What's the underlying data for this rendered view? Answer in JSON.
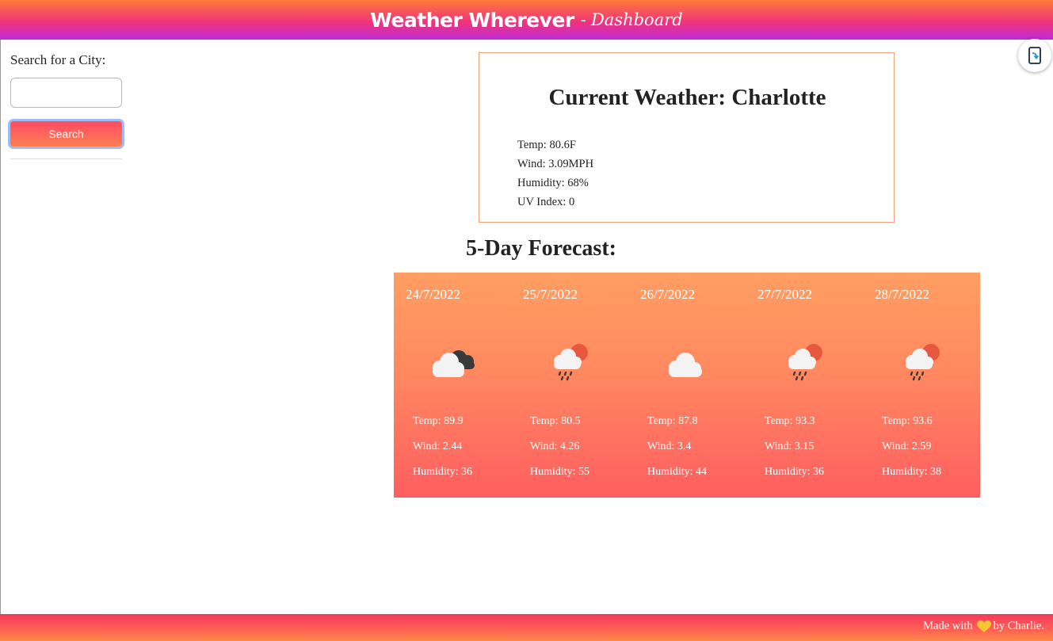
{
  "header": {
    "brand": "Weather Wherever",
    "separator": "-",
    "subtitle": "Dashboard"
  },
  "sidebar": {
    "search_label": "Search for a City:",
    "search_value": "",
    "search_placeholder": "",
    "search_button": "Search"
  },
  "current": {
    "title": "Current Weather: Charlotte",
    "temp": "Temp: 80.6F",
    "wind": "Wind: 3.09MPH",
    "humidity": "Humidity: 68%",
    "uv": "UV Index: 0"
  },
  "forecast": {
    "heading": "5-Day Forecast:",
    "days": [
      {
        "date": "24/7/2022",
        "icon": "cloudy-icon",
        "temp": "Temp: 89.9",
        "wind": "Wind: 2.44",
        "humidity": "Humidity: 36"
      },
      {
        "date": "25/7/2022",
        "icon": "rain-sun-icon",
        "temp": "Temp: 80.5",
        "wind": "Wind: 4.26",
        "humidity": "Humidity: 55"
      },
      {
        "date": "26/7/2022",
        "icon": "cloud-icon",
        "temp": "Temp: 87.8",
        "wind": "Wind: 3.4",
        "humidity": "Humidity: 44"
      },
      {
        "date": "27/7/2022",
        "icon": "rain-sun-icon",
        "temp": "Temp: 93.3",
        "wind": "Wind: 3.15",
        "humidity": "Humidity: 36"
      },
      {
        "date": "28/7/2022",
        "icon": "rain-sun-icon",
        "temp": "Temp: 93.6",
        "wind": "Wind: 2.59",
        "humidity": "Humidity: 38"
      }
    ]
  },
  "footer": {
    "made_with": "Made with",
    "heart_icon": "heart-icon",
    "by": "by Charlie."
  },
  "colors": {
    "accent": "#ff5e60",
    "header_top": "#ff7a3a",
    "header_bottom": "#c02bd6",
    "card_border": "#f2a27a"
  }
}
